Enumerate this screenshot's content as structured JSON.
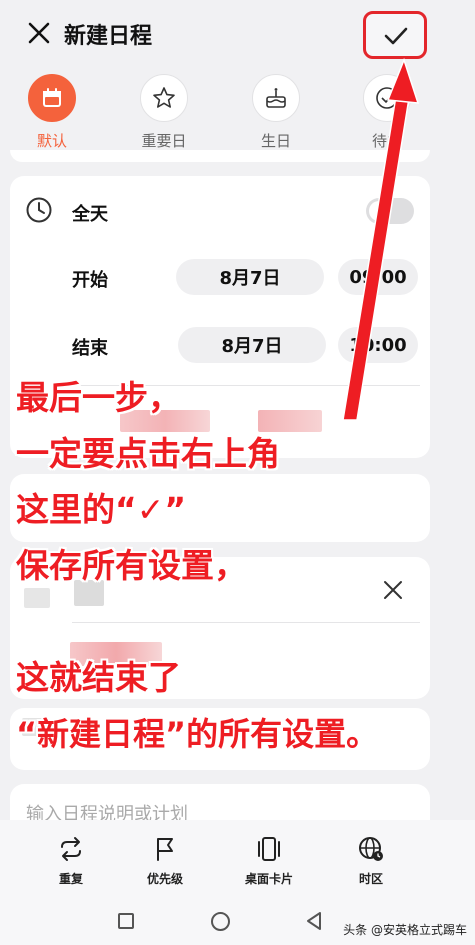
{
  "header": {
    "title": "新建日程"
  },
  "types": [
    {
      "label": "默认",
      "active": true
    },
    {
      "label": "重要日"
    },
    {
      "label": "生日"
    },
    {
      "label": "待办"
    }
  ],
  "time": {
    "all_day_label": "全天",
    "start_label": "开始",
    "start_date": "8月7日",
    "start_time": "09:00",
    "end_label": "结束",
    "end_date": "8月7日",
    "end_time": "10:00"
  },
  "annotation": {
    "line1": "最后一步，",
    "line2": "一定要点击右上角",
    "line3": "这里的“✓”",
    "line4": "保存所有设置，",
    "line5": "这就结束了",
    "line6": "“新建日程”的所有设置。"
  },
  "description": {
    "placeholder": "输入日程说明或计划"
  },
  "toolbar": {
    "repeat": "重复",
    "priority": "优先级",
    "desktop_card": "桌面卡片",
    "timezone": "时区"
  },
  "watermark": "头条 @安英格立式踢车",
  "colors": {
    "accent": "#f4623c",
    "annotation_red": "#ee1d23"
  }
}
